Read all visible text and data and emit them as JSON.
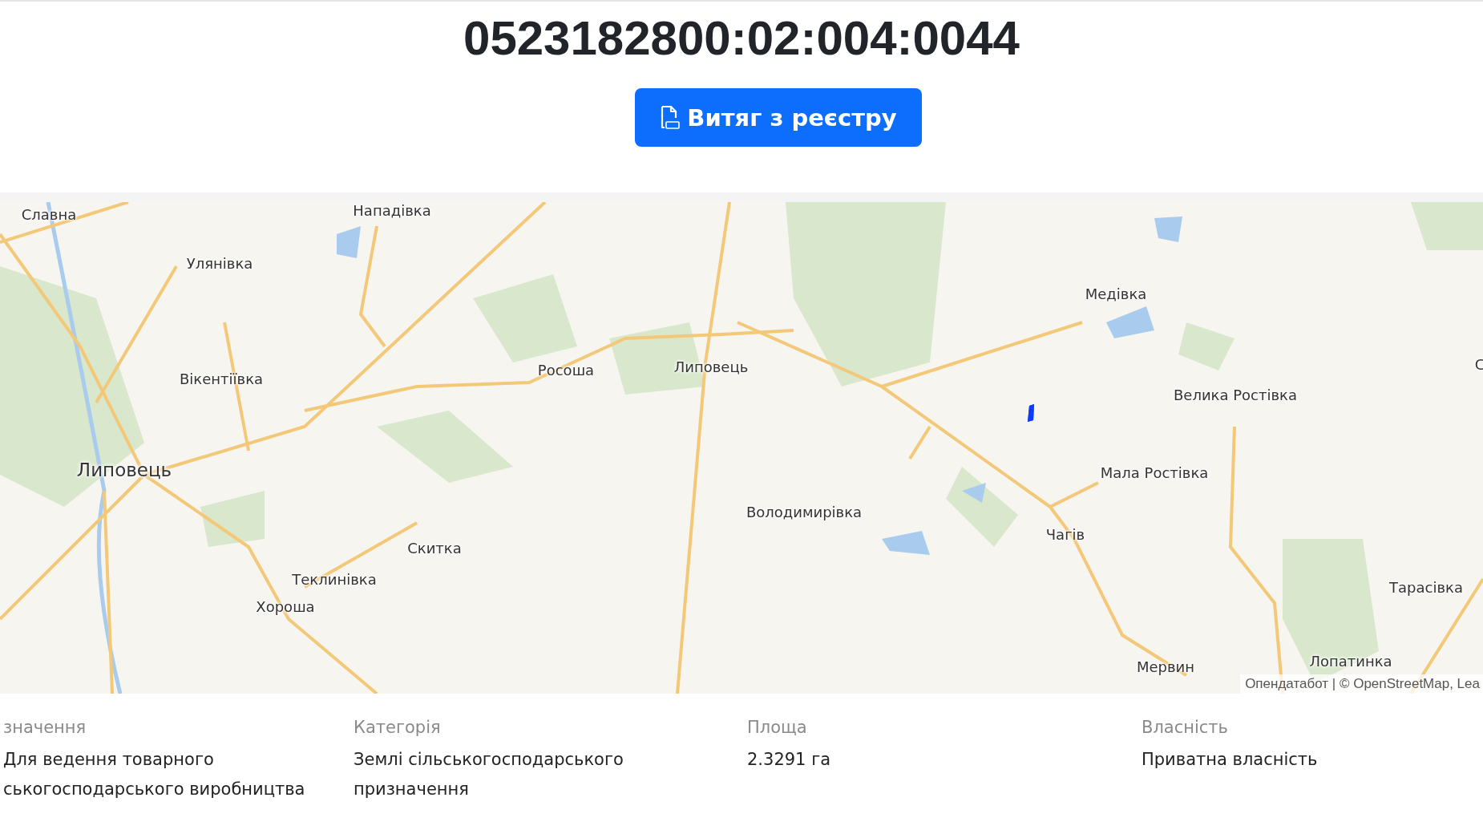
{
  "cadastral_number": "0523182800:02:004:0044",
  "extract_button": {
    "label": "Витяг з реєстру"
  },
  "map": {
    "places": [
      {
        "label": "Славна",
        "kind": "village"
      },
      {
        "label": "Нападівка",
        "kind": "village"
      },
      {
        "label": "Улянівка",
        "kind": "village"
      },
      {
        "label": "Вікентіївка",
        "kind": "village"
      },
      {
        "label": "Росоша",
        "kind": "village"
      },
      {
        "label": "Липовець",
        "kind": "village"
      },
      {
        "label": "Липовець",
        "kind": "town"
      },
      {
        "label": "Скитка",
        "kind": "village"
      },
      {
        "label": "Теклинівка",
        "kind": "village"
      },
      {
        "label": "Хороша",
        "kind": "village"
      },
      {
        "label": "Володимирівка",
        "kind": "village"
      },
      {
        "label": "Медівка",
        "kind": "village"
      },
      {
        "label": "Велика Ростівка",
        "kind": "village"
      },
      {
        "label": "Мала Ростівка",
        "kind": "village"
      },
      {
        "label": "Чагів",
        "kind": "village"
      },
      {
        "label": "Тарасівка",
        "kind": "village"
      },
      {
        "label": "Мервин",
        "kind": "village"
      },
      {
        "label": "Лопатинка",
        "kind": "village"
      },
      {
        "label": "С",
        "kind": "village"
      }
    ],
    "attribution": "Опендатабот | © OpenStreetMap, Lea"
  },
  "details": [
    {
      "label": "значення",
      "lines": [
        "Для ведення товарного",
        "ськогосподарського виробництва"
      ]
    },
    {
      "label": "Категорія",
      "lines": [
        "Землі сільськогосподарського",
        "призначення"
      ]
    },
    {
      "label": "Площа",
      "lines": [
        "2.3291 га"
      ]
    },
    {
      "label": "Власність",
      "lines": [
        "Приватна власність"
      ]
    }
  ]
}
